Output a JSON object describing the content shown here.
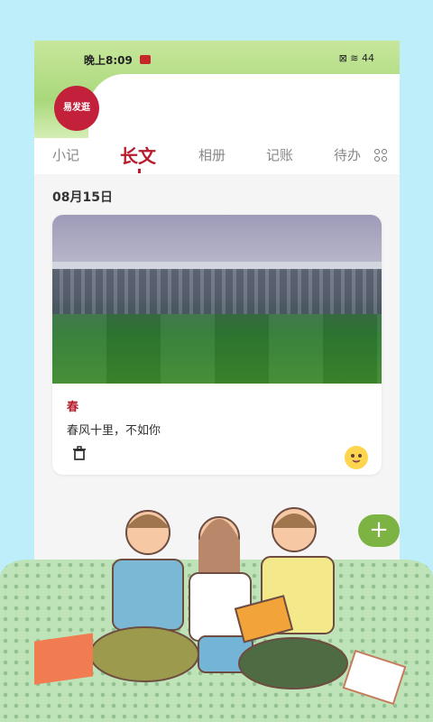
{
  "status_bar": {
    "time": "晚上8:09",
    "icons": "⊠ ≋ 44"
  },
  "logo": {
    "text": "易发逛"
  },
  "tabs": [
    {
      "label": "小记"
    },
    {
      "label": "长文"
    },
    {
      "label": "相册"
    },
    {
      "label": "记账"
    },
    {
      "label": "待办"
    }
  ],
  "date_label": "08月15日",
  "entry": {
    "title": "春",
    "body": "春风十里，不如你"
  },
  "fab": {
    "label": "+"
  },
  "colors": {
    "accent": "#b71c2c",
    "fab": "#7cb342",
    "background": "#bdeefa"
  }
}
